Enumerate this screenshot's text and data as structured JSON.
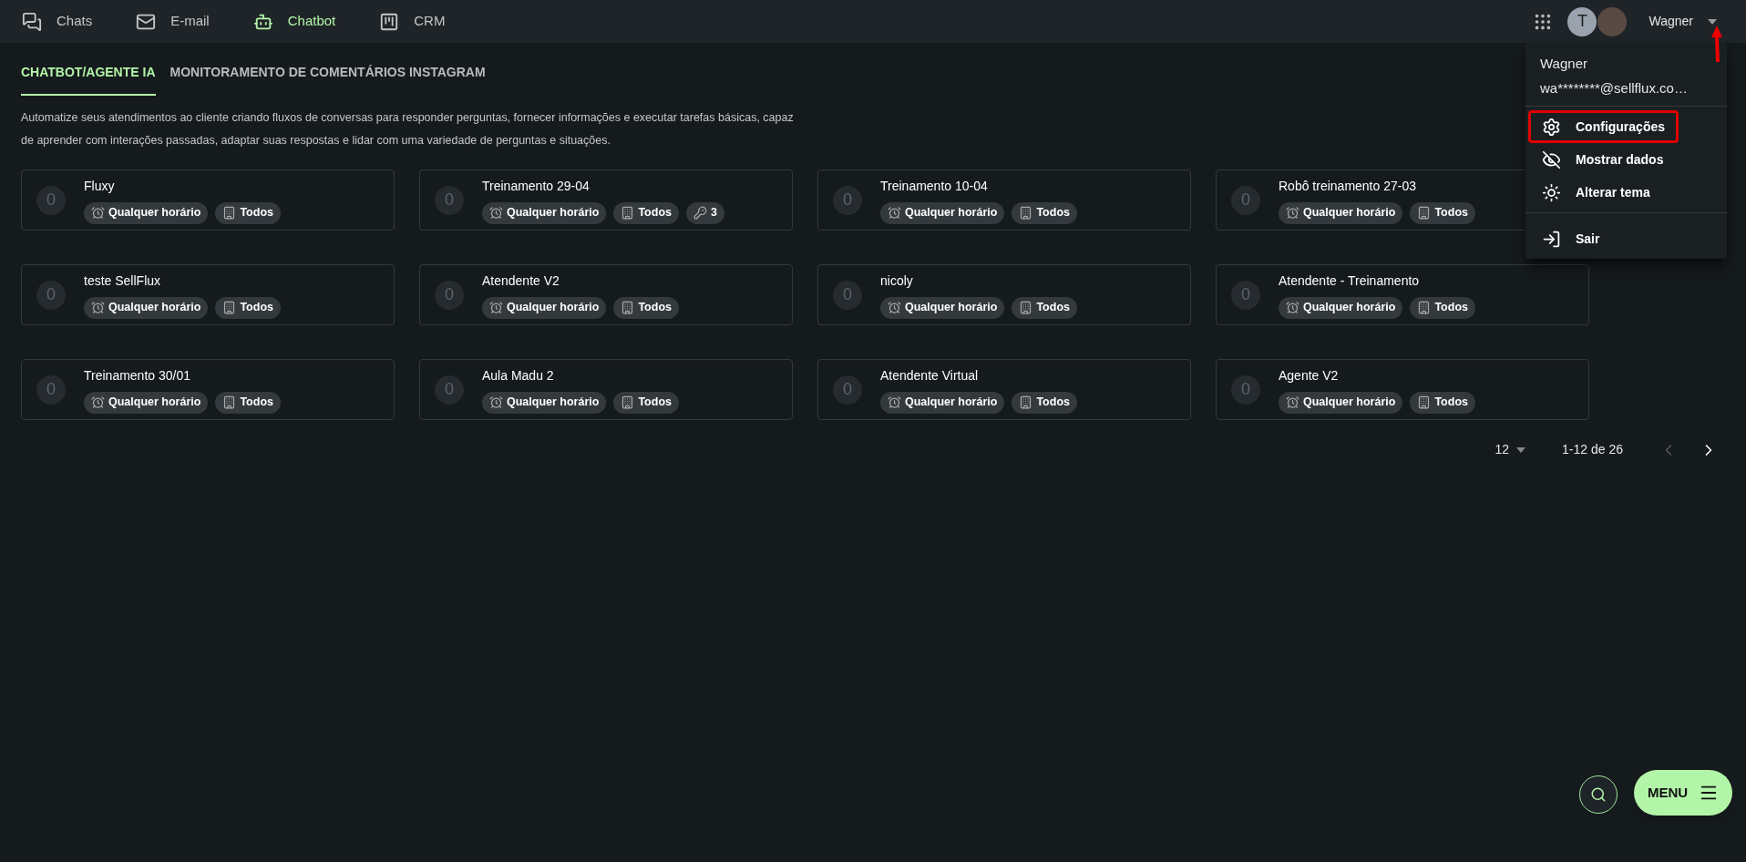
{
  "nav": [
    {
      "kind": "chats",
      "label": "Chats",
      "selected": false
    },
    {
      "kind": "email",
      "label": "E-mail",
      "selected": false
    },
    {
      "kind": "bot",
      "label": "Chatbot",
      "selected": true
    },
    {
      "kind": "crm",
      "label": "CRM",
      "selected": false
    }
  ],
  "user": {
    "initial": "T",
    "name": "Wagner"
  },
  "tabs": [
    {
      "label": "CHATBOT/AGENTE IA",
      "selected": true
    },
    {
      "label": "MONITORAMENTO DE COMENTÁRIOS INSTAGRAM",
      "selected": false
    }
  ],
  "description": "Automatize seus atendimentos ao cliente criando fluxos de conversas para responder perguntas, fornecer informações e executar tarefas básicas, capaz de aprender com interações passadas, adaptar suas respostas e lidar com uma variedade de perguntas e situações.",
  "bots": [
    {
      "count": "0",
      "name": "Fluxy",
      "chips": [
        {
          "kind": "schedule",
          "label": "Qualquer horário"
        },
        {
          "kind": "audience",
          "label": "Todos"
        }
      ]
    },
    {
      "count": "0",
      "name": "Treinamento 29-04",
      "chips": [
        {
          "kind": "schedule",
          "label": "Qualquer horário"
        },
        {
          "kind": "audience",
          "label": "Todos"
        },
        {
          "kind": "key",
          "label": "3"
        }
      ]
    },
    {
      "count": "0",
      "name": "Treinamento 10-04",
      "chips": [
        {
          "kind": "schedule",
          "label": "Qualquer horário"
        },
        {
          "kind": "audience",
          "label": "Todos"
        }
      ]
    },
    {
      "count": "0",
      "name": "Robô treinamento 27-03",
      "chips": [
        {
          "kind": "schedule",
          "label": "Qualquer horário"
        },
        {
          "kind": "audience",
          "label": "Todos"
        }
      ]
    },
    {
      "count": "0",
      "name": "teste SellFlux",
      "chips": [
        {
          "kind": "schedule",
          "label": "Qualquer horário"
        },
        {
          "kind": "audience",
          "label": "Todos"
        }
      ]
    },
    {
      "count": "0",
      "name": "Atendente V2",
      "chips": [
        {
          "kind": "schedule",
          "label": "Qualquer horário"
        },
        {
          "kind": "audience",
          "label": "Todos"
        }
      ]
    },
    {
      "count": "0",
      "name": "nicoly",
      "chips": [
        {
          "kind": "schedule",
          "label": "Qualquer horário"
        },
        {
          "kind": "audience",
          "label": "Todos"
        }
      ]
    },
    {
      "count": "0",
      "name": "Atendente - Treinamento",
      "chips": [
        {
          "kind": "schedule",
          "label": "Qualquer horário"
        },
        {
          "kind": "audience",
          "label": "Todos"
        }
      ]
    },
    {
      "count": "0",
      "name": "Treinamento 30/01",
      "chips": [
        {
          "kind": "schedule",
          "label": "Qualquer horário"
        },
        {
          "kind": "audience",
          "label": "Todos"
        }
      ]
    },
    {
      "count": "0",
      "name": "Aula Madu 2",
      "chips": [
        {
          "kind": "schedule",
          "label": "Qualquer horário"
        },
        {
          "kind": "audience",
          "label": "Todos"
        }
      ]
    },
    {
      "count": "0",
      "name": "Atendente Virtual",
      "chips": [
        {
          "kind": "schedule",
          "label": "Qualquer horário"
        },
        {
          "kind": "audience",
          "label": "Todos"
        }
      ]
    },
    {
      "count": "0",
      "name": "Agente V2",
      "chips": [
        {
          "kind": "schedule",
          "label": "Qualquer horário"
        },
        {
          "kind": "audience",
          "label": "Todos"
        }
      ]
    }
  ],
  "pagination": {
    "per_page": "12",
    "range": "1-12 de 26",
    "prev_disabled": true,
    "next_disabled": false
  },
  "user_menu": {
    "name": "Wagner",
    "email": "wa********@sellflux.co…",
    "items": [
      {
        "kind": "settings",
        "label": "Configurações",
        "highlighted": true
      },
      {
        "kind": "eye-off",
        "label": "Mostrar dados",
        "highlighted": false
      },
      {
        "kind": "sun",
        "label": "Alterar tema",
        "highlighted": false
      },
      {
        "kind": "logout",
        "label": "Sair",
        "highlighted": false
      }
    ]
  },
  "fab": {
    "menu_label": "MENU"
  }
}
